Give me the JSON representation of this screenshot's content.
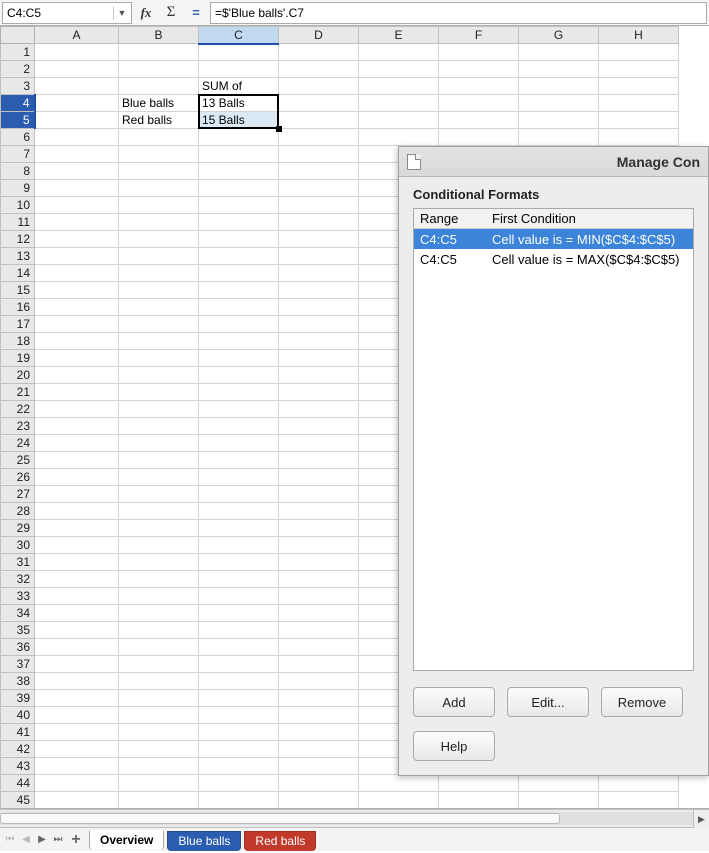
{
  "formula_bar": {
    "name_box": "C4:C5",
    "formula": "=$'Blue balls'.C7"
  },
  "columns": [
    "A",
    "B",
    "C",
    "D",
    "E",
    "F",
    "G",
    "H"
  ],
  "selected_cols": [
    "C"
  ],
  "selected_rows": [
    4,
    5
  ],
  "row_count": 45,
  "cells": {
    "C3": "SUM of",
    "B4": "Blue balls",
    "C4": "13 Balls",
    "B5": "Red balls",
    "C5": "15 Balls"
  },
  "cell_bg": {
    "C5": "#dbe9f4"
  },
  "dialog": {
    "title": "Manage Con",
    "section_label": "Conditional Formats",
    "headers": {
      "range": "Range",
      "condition": "First Condition"
    },
    "rows": [
      {
        "range": "C4:C5",
        "condition": "Cell value is = MIN($C$4:$C$5)",
        "selected": true
      },
      {
        "range": "C4:C5",
        "condition": "Cell value is = MAX($C$4:$C$5)",
        "selected": false
      }
    ],
    "buttons": {
      "add": "Add",
      "edit": "Edit...",
      "remove": "Remove",
      "help": "Help"
    }
  },
  "tabs": {
    "active": "Overview",
    "list": [
      {
        "name": "Overview",
        "style": "active"
      },
      {
        "name": "Blue balls",
        "style": "blue"
      },
      {
        "name": "Red balls",
        "style": "red"
      }
    ]
  }
}
